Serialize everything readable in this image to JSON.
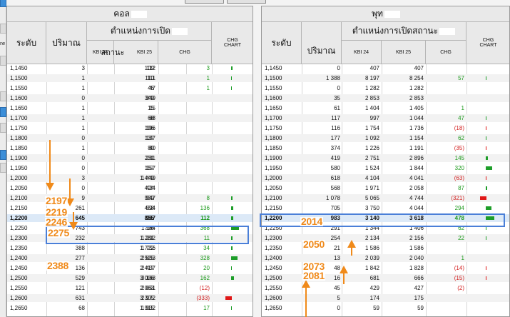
{
  "call": {
    "title": "คอล",
    "col_level": "ระดับ",
    "col_volume": "ปริมาณ",
    "col_position": "ตำแหน่งการเปิด",
    "col_position_sub": "สถานะ",
    "col_kbi24": "KBI 24",
    "col_kbi25": "KBI 25",
    "col_chg": "CHG",
    "col_chg_chart": "CHG CHART",
    "rows": [
      {
        "level": "1,1450",
        "vol": "3",
        "k24": "109",
        "k25": "112",
        "chg": "3",
        "chgc": "pos",
        "bar": 2,
        "bc": "g"
      },
      {
        "level": "1,1500",
        "vol": "1",
        "k24": "110",
        "k25": "111",
        "chg": "1",
        "chgc": "pos",
        "bar": 1,
        "bc": "g"
      },
      {
        "level": "1,1550",
        "vol": "1",
        "k24": "46",
        "k25": "47",
        "chg": "1",
        "chgc": "pos",
        "bar": 1,
        "bc": "g"
      },
      {
        "level": "1,1600",
        "vol": "0",
        "k24": "349",
        "k25": "349",
        "chg": "",
        "chgc": "",
        "bar": 0,
        "bc": ""
      },
      {
        "level": "1,1650",
        "vol": "1",
        "k24": "15",
        "k25": "15",
        "chg": "",
        "chgc": "",
        "bar": 0,
        "bc": ""
      },
      {
        "level": "1,1700",
        "vol": "1",
        "k24": "68",
        "k25": "68",
        "chg": "",
        "chgc": "",
        "bar": 0,
        "bc": ""
      },
      {
        "level": "1,1750",
        "vol": "1",
        "k24": "196",
        "k25": "196",
        "chg": "",
        "chgc": "",
        "bar": 0,
        "bc": ""
      },
      {
        "level": "1,1800",
        "vol": "0",
        "k24": "137",
        "k25": "137",
        "chg": "",
        "chgc": "",
        "bar": 0,
        "bc": ""
      },
      {
        "level": "1,1850",
        "vol": "1",
        "k24": "80",
        "k25": "80",
        "chg": "",
        "chgc": "",
        "bar": 0,
        "bc": ""
      },
      {
        "level": "1,1900",
        "vol": "0",
        "k24": "231",
        "k25": "231",
        "chg": "",
        "chgc": "",
        "bar": 0,
        "bc": ""
      },
      {
        "level": "1,1950",
        "vol": "0",
        "k24": "157",
        "k25": "157",
        "chg": "",
        "chgc": "",
        "bar": 0,
        "bc": ""
      },
      {
        "level": "1,2000",
        "vol": "3",
        "k24": "1 449",
        "k25": "1 449",
        "chg": "",
        "chgc": "",
        "bar": 0,
        "bc": ""
      },
      {
        "level": "1,2050",
        "vol": "0",
        "k24": "424",
        "k25": "424",
        "chg": "",
        "chgc": "",
        "bar": 0,
        "bc": ""
      },
      {
        "level": "1,2100",
        "vol": "9",
        "k24": "939",
        "k25": "947",
        "chg": "8",
        "chgc": "pos",
        "bar": 2,
        "bc": "g"
      },
      {
        "level": "1,2150",
        "vol": "261",
        "k24": "458",
        "k25": "594",
        "chg": "136",
        "chgc": "pos",
        "bar": 3,
        "bc": "g"
      },
      {
        "level": "1,2200",
        "vol": "645",
        "k24": "855",
        "k25": "967",
        "chg": "112",
        "chgc": "pos",
        "bar": 3,
        "bc": "g",
        "hl": true
      },
      {
        "level": "1,2250",
        "vol": "743",
        "k24": "796",
        "k25": "1 164",
        "chg": "368",
        "chgc": "pos",
        "bar": 10,
        "bc": "g"
      },
      {
        "level": "1,2300",
        "vol": "232",
        "k24": "1 281",
        "k25": "1 292",
        "chg": "11",
        "chgc": "pos",
        "bar": 2,
        "bc": "g"
      },
      {
        "level": "1,2350",
        "vol": "388",
        "k24": "1 722",
        "k25": "1 756",
        "chg": "34",
        "chgc": "pos",
        "bar": 2,
        "bc": "g"
      },
      {
        "level": "1,2400",
        "vol": "277",
        "k24": "2 525",
        "k25": "2 853",
        "chg": "328",
        "chgc": "pos",
        "bar": 8,
        "bc": "g"
      },
      {
        "level": "1,2450",
        "vol": "136",
        "k24": "2 417",
        "k25": "2 437",
        "chg": "20",
        "chgc": "pos",
        "bar": 1,
        "bc": "g"
      },
      {
        "level": "1,2500",
        "vol": "529",
        "k24": "3 006",
        "k25": "3 168",
        "chg": "162",
        "chgc": "pos",
        "bar": 4,
        "bc": "g"
      },
      {
        "level": "1,2550",
        "vol": "121",
        "k24": "2 063",
        "k25": "2 051",
        "chg": "(12)",
        "chgc": "neg",
        "bar": 0,
        "bc": ""
      },
      {
        "level": "1,2600",
        "vol": "631",
        "k24": "3 305",
        "k25": "2 972",
        "chg": "(333)",
        "chgc": "neg",
        "bar": 8,
        "bc": "r"
      },
      {
        "level": "1,2650",
        "vol": "68",
        "k24": "1 915",
        "k25": "1 932",
        "chg": "17",
        "chgc": "pos",
        "bar": 1,
        "bc": "g"
      }
    ]
  },
  "put": {
    "title": "พุท",
    "col_level": "ระดับ",
    "col_volume": "ปริมาณ",
    "col_position": "ตำแหน่งการเปิดสถานะ",
    "col_kbi24": "KBI 24",
    "col_kbi25": "KBI 25",
    "col_chg": "CHG",
    "col_chg_chart": "CHG CHART",
    "rows": [
      {
        "level": "1,1450",
        "vol": "0",
        "k24": "407",
        "k25": "407",
        "chg": "",
        "chgc": "",
        "bar": 0,
        "bc": ""
      },
      {
        "level": "1,1500",
        "vol": "1 388",
        "k24": "8 197",
        "k25": "8 254",
        "chg": "57",
        "chgc": "pos",
        "bar": 1,
        "bc": "g"
      },
      {
        "level": "1,1550",
        "vol": "0",
        "k24": "1 282",
        "k25": "1 282",
        "chg": "",
        "chgc": "",
        "bar": 0,
        "bc": ""
      },
      {
        "level": "1,1600",
        "vol": "35",
        "k24": "2 853",
        "k25": "2 853",
        "chg": "",
        "chgc": "",
        "bar": 0,
        "bc": ""
      },
      {
        "level": "1,1650",
        "vol": "61",
        "k24": "1 404",
        "k25": "1 405",
        "chg": "1",
        "chgc": "pos",
        "bar": 0,
        "bc": ""
      },
      {
        "level": "1,1700",
        "vol": "117",
        "k24": "997",
        "k25": "1 044",
        "chg": "47",
        "chgc": "pos",
        "bar": 1,
        "bc": "g"
      },
      {
        "level": "1,1750",
        "vol": "116",
        "k24": "1 754",
        "k25": "1 736",
        "chg": "(18)",
        "chgc": "neg",
        "bar": 1,
        "bc": "r"
      },
      {
        "level": "1,1800",
        "vol": "177",
        "k24": "1 092",
        "k25": "1 154",
        "chg": "62",
        "chgc": "pos",
        "bar": 1,
        "bc": "g"
      },
      {
        "level": "1,1850",
        "vol": "374",
        "k24": "1 226",
        "k25": "1 191",
        "chg": "(35)",
        "chgc": "neg",
        "bar": 1,
        "bc": "r"
      },
      {
        "level": "1,1900",
        "vol": "419",
        "k24": "2 751",
        "k25": "2 896",
        "chg": "145",
        "chgc": "pos",
        "bar": 3,
        "bc": "g"
      },
      {
        "level": "1,1950",
        "vol": "580",
        "k24": "1 524",
        "k25": "1 844",
        "chg": "320",
        "chgc": "pos",
        "bar": 8,
        "bc": "g"
      },
      {
        "level": "1,2000",
        "vol": "618",
        "k24": "4 104",
        "k25": "4 041",
        "chg": "(63)",
        "chgc": "neg",
        "bar": 1,
        "bc": "r"
      },
      {
        "level": "1,2050",
        "vol": "568",
        "k24": "1 971",
        "k25": "2 058",
        "chg": "87",
        "chgc": "pos",
        "bar": 2,
        "bc": "g"
      },
      {
        "level": "1,2100",
        "vol": "1 078",
        "k24": "5 065",
        "k25": "4 744",
        "chg": "(321)",
        "chgc": "neg",
        "bar": 8,
        "bc": "r"
      },
      {
        "level": "1,2150",
        "vol": "705",
        "k24": "3 750",
        "k25": "4 044",
        "chg": "294",
        "chgc": "pos",
        "bar": 7,
        "bc": "g"
      },
      {
        "level": "1,2200",
        "vol": "983",
        "k24": "3 140",
        "k25": "3 618",
        "chg": "478",
        "chgc": "pos",
        "bar": 11,
        "bc": "g",
        "hl": true
      },
      {
        "level": "1,2250",
        "vol": "291",
        "k24": "1 344",
        "k25": "1 406",
        "chg": "62",
        "chgc": "pos",
        "bar": 1,
        "bc": "g"
      },
      {
        "level": "1,2300",
        "vol": "254",
        "k24": "2 134",
        "k25": "2 156",
        "chg": "22",
        "chgc": "pos",
        "bar": 1,
        "bc": "g"
      },
      {
        "level": "1,2350",
        "vol": "21",
        "k24": "1 586",
        "k25": "1 586",
        "chg": "",
        "chgc": "",
        "bar": 0,
        "bc": ""
      },
      {
        "level": "1,2400",
        "vol": "13",
        "k24": "2 039",
        "k25": "2 040",
        "chg": "1",
        "chgc": "pos",
        "bar": 0,
        "bc": ""
      },
      {
        "level": "1,2450",
        "vol": "48",
        "k24": "1 842",
        "k25": "1 828",
        "chg": "(14)",
        "chgc": "neg",
        "bar": 1,
        "bc": "r"
      },
      {
        "level": "1,2500",
        "vol": "16",
        "k24": "681",
        "k25": "666",
        "chg": "(15)",
        "chgc": "neg",
        "bar": 1,
        "bc": "r"
      },
      {
        "level": "1,2550",
        "vol": "45",
        "k24": "429",
        "k25": "427",
        "chg": "(2)",
        "chgc": "neg",
        "bar": 0,
        "bc": ""
      },
      {
        "level": "1,2600",
        "vol": "5",
        "k24": "174",
        "k25": "175",
        "chg": "",
        "chgc": "",
        "bar": 0,
        "bc": ""
      },
      {
        "level": "1,2650",
        "vol": "0",
        "k24": "59",
        "k25": "59",
        "chg": "",
        "chgc": "",
        "bar": 0,
        "bc": ""
      }
    ]
  },
  "annotations": {
    "a2197": "2197",
    "a2219": "2219",
    "a2246": "2246",
    "a2275": "2275",
    "a2388": "2388",
    "a2014": "2014",
    "a2050": "2050",
    "a2073": "2073",
    "a2081": "2081"
  },
  "colors": {
    "positive": "#1d9a1d",
    "negative": "#d21f1f",
    "annotation": "#f08a1a",
    "highlight_box": "#4a7fd8"
  },
  "left_edge": {
    "label": "ne"
  }
}
